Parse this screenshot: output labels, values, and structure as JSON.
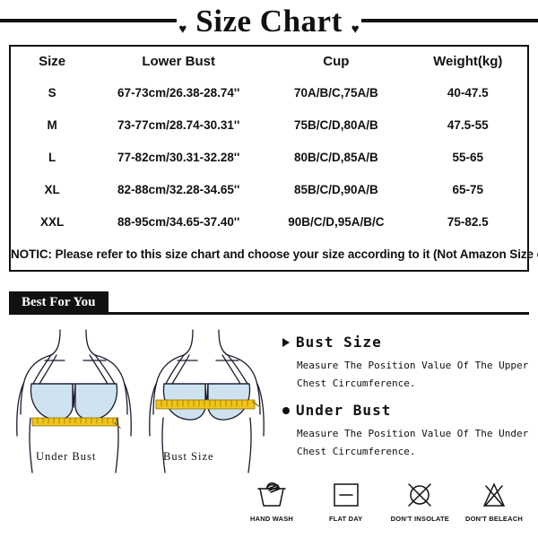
{
  "title": {
    "text": "Size Chart",
    "heart_glyph": "♥"
  },
  "size_table": {
    "headers": [
      "Size",
      "Lower Bust",
      "Cup",
      "Weight(kg)"
    ],
    "rows": [
      [
        "S",
        "67-73cm/26.38-28.74''",
        "70A/B/C,75A/B",
        "40-47.5"
      ],
      [
        "M",
        "73-77cm/28.74-30.31''",
        "75B/C/D,80A/B",
        "47.5-55"
      ],
      [
        "L",
        "77-82cm/30.31-32.28''",
        "80B/C/D,85A/B",
        "55-65"
      ],
      [
        "XL",
        "82-88cm/32.28-34.65''",
        "85B/C/D,90A/B",
        "65-75"
      ],
      [
        "XXL",
        "88-95cm/34.65-37.40''",
        "90B/C/D,95A/B/C",
        "75-82.5"
      ]
    ],
    "notice": "NOTIC: Please refer to this size chart and choose your size according to it (Not Amazon Size chart)"
  },
  "best_for_you": {
    "label": "Best For You"
  },
  "illustration": {
    "left_figure_label": "Under Bust",
    "right_figure_label": "Bust Size",
    "bra_color": "#cfe2ef",
    "tape_color": "#f0c419",
    "outline_color": "#1a1a2e"
  },
  "info_blocks": [
    {
      "heading": "Bust Size",
      "description": "Measure The Position Value Of The Upper Chest Circumference."
    },
    {
      "heading": "Under Bust",
      "description": "Measure The Position Value Of The Under Chest Circumference."
    }
  ],
  "care_symbols": [
    {
      "label": "HAND WASH",
      "icon": "hand-wash-icon"
    },
    {
      "label": "FLAT DAY",
      "icon": "flat-dry-icon"
    },
    {
      "label": "DON'T INSOLATE",
      "icon": "no-sun-icon"
    },
    {
      "label": "DON'T BELEACH",
      "icon": "no-bleach-icon"
    }
  ]
}
